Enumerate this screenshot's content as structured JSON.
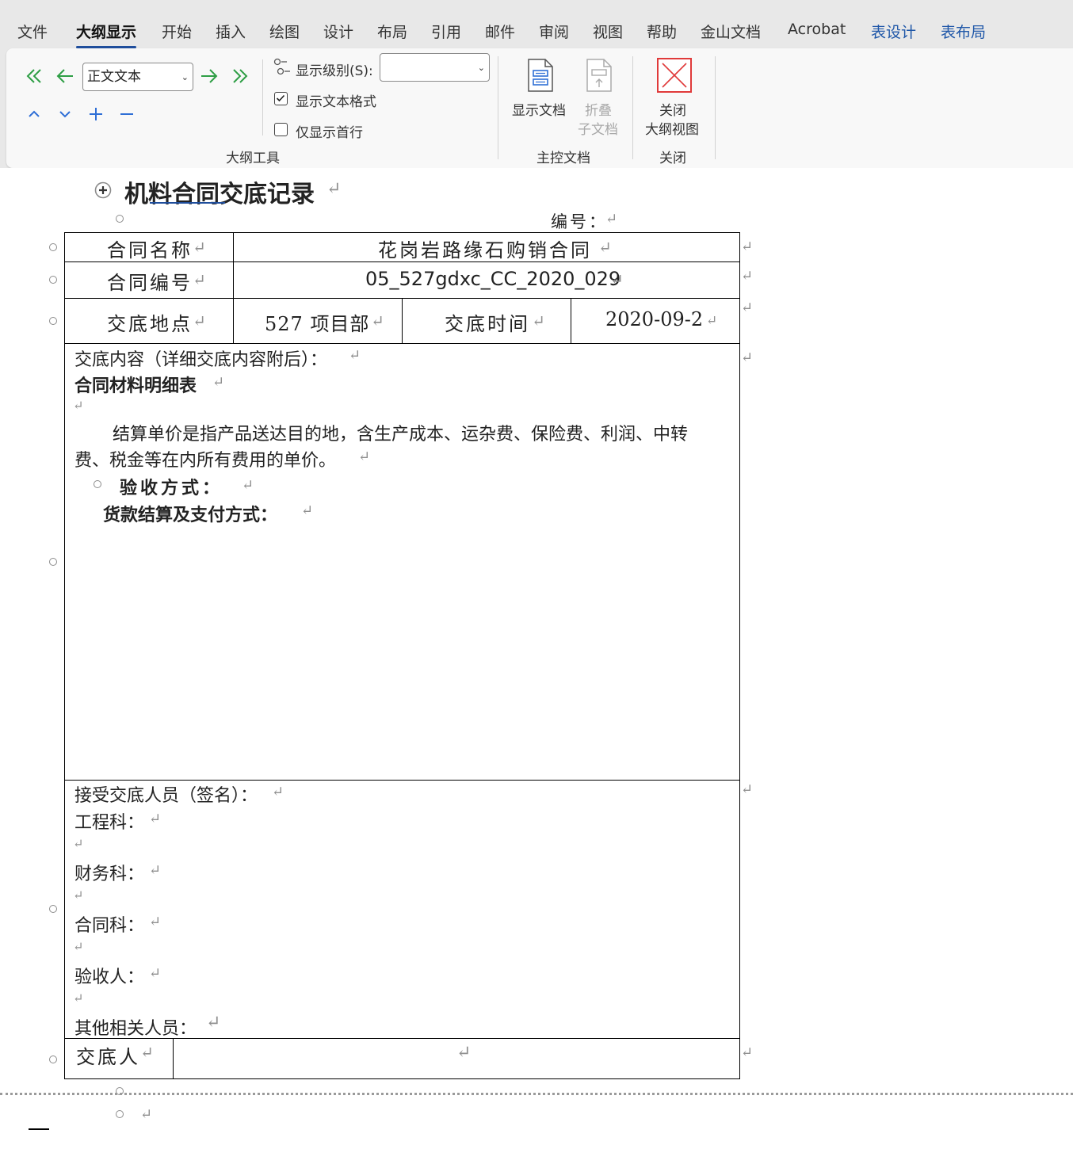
{
  "tabs": [
    {
      "label": "文件"
    },
    {
      "label": "大纲显示"
    },
    {
      "label": "开始"
    },
    {
      "label": "插入"
    },
    {
      "label": "绘图"
    },
    {
      "label": "设计"
    },
    {
      "label": "布局"
    },
    {
      "label": "引用"
    },
    {
      "label": "邮件"
    },
    {
      "label": "审阅"
    },
    {
      "label": "视图"
    },
    {
      "label": "帮助"
    },
    {
      "label": "金山文档"
    },
    {
      "label": "Acrobat"
    },
    {
      "label": "表设计"
    },
    {
      "label": "表布局"
    }
  ],
  "active_tab": "大纲显示",
  "ribbon": {
    "outline_tools": {
      "group_label": "大纲工具",
      "level_select_value": "正文文本",
      "show_level_label": "显示级别(S):",
      "show_level_value": "",
      "show_text_format_label": "显示文本格式",
      "show_text_format_checked": true,
      "show_first_line_label": "仅显示首行",
      "show_first_line_checked": false
    },
    "master_document": {
      "group_label": "主控文档",
      "show_document_label": "显示文档",
      "collapse_line1": "折叠",
      "collapse_line2": "子文档"
    },
    "close": {
      "group_label": "关闭",
      "close_line1": "关闭",
      "close_line2": "大纲视图"
    }
  },
  "document": {
    "title": "机料合同交底记录",
    "number_label": "编号：",
    "table": {
      "contract_name_label": "合同名称",
      "contract_name_value": "花岗岩路缘石购销合同",
      "contract_no_label": "合同编号",
      "contract_no_value": "05_527gdxc_CC_2020_029",
      "location_label": "交底地点",
      "location_value": "527 项目部",
      "time_label": "交底时间",
      "time_value": "2020-09-2",
      "content_heading": "交底内容（详细交底内容附后）：",
      "material_list": "合同材料明细表",
      "paragraph_line1": "结算单价是指产品送达目的地，含生产成本、运杂费、保险费、利润、中转",
      "paragraph_line2": "费、税金等在内所有费用的单价。",
      "acceptance_method": "验收方式：",
      "payment_method": "货款结算及支付方式：",
      "receivers_heading": "接受交底人员（签名）：",
      "engineering": "工程科：",
      "finance": "财务科：",
      "contracts": "合同科：",
      "inspector": "验收人：",
      "others": "其他相关人员：",
      "briefer_label": "交底人"
    },
    "para_mark": "↵"
  },
  "colors": {
    "accent_blue": "#1f4e9c",
    "green_arrows": "#2e9e45",
    "blue_arrows": "#2f6fd6",
    "close_red": "#e03a3a"
  }
}
